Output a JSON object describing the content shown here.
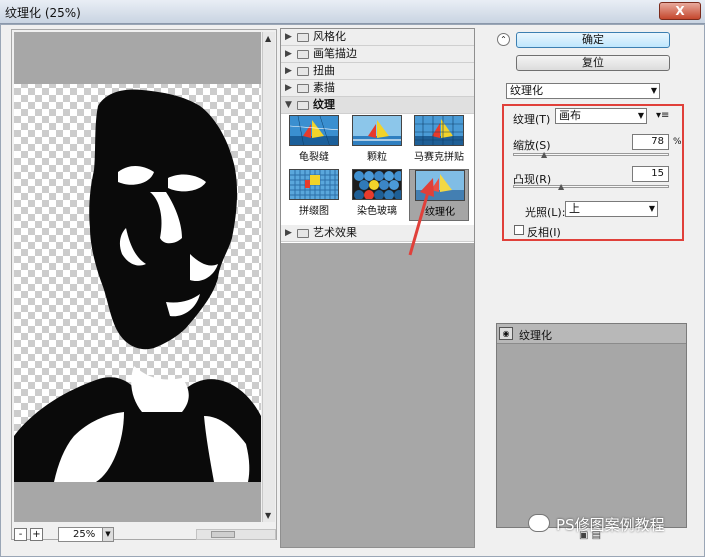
{
  "window": {
    "title": "纹理化 (25%)",
    "close_label": "X"
  },
  "preview": {
    "zoom_value": "25%",
    "zoom_out": "-",
    "zoom_in": "+"
  },
  "gallery": {
    "categories_top": [
      "风格化",
      "画笔描边",
      "扭曲",
      "素描"
    ],
    "open_category": "纹理",
    "thumbnails": [
      "龟裂缝",
      "颗粒",
      "马赛克拼贴",
      "拼缀图",
      "染色玻璃",
      "纹理化"
    ],
    "categories_bottom": [
      "艺术效果"
    ]
  },
  "buttons": {
    "ok": "确定",
    "reset": "复位"
  },
  "filter_select": {
    "value": "纹理化"
  },
  "settings": {
    "texture_label": "纹理(T)",
    "texture_value": "画布",
    "scaling_label": "缩放(S)",
    "scaling_value": "78",
    "scaling_unit": "%",
    "relief_label": "凸现(R)",
    "relief_value": "15",
    "light_label": "光照(L):",
    "light_value": "上",
    "invert_label": "反相(I)"
  },
  "layers": {
    "items": [
      "纹理化"
    ]
  },
  "watermark": {
    "text": "PS修图案例教程"
  }
}
